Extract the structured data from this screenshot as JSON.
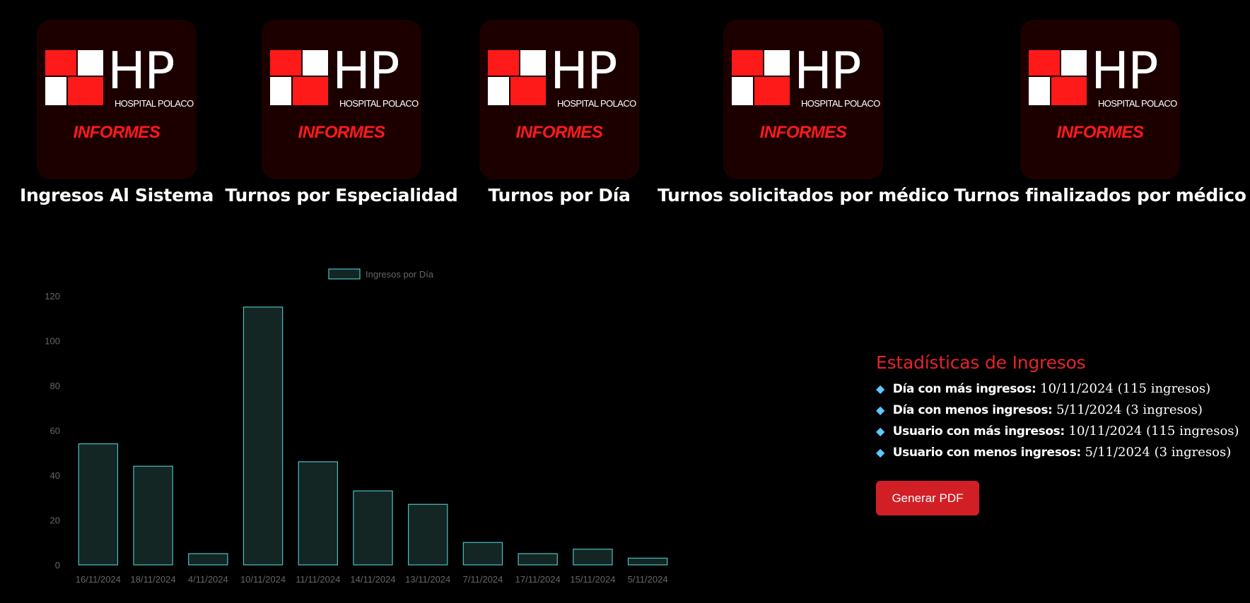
{
  "cards": [
    {
      "logo_letters": "HP",
      "logo_sub": "HOSPITAL POLACO",
      "logo_tag": "INFORMES",
      "label": "Ingresos Al Sistema"
    },
    {
      "logo_letters": "HP",
      "logo_sub": "HOSPITAL POLACO",
      "logo_tag": "INFORMES",
      "label": "Turnos por Especialidad"
    },
    {
      "logo_letters": "HP",
      "logo_sub": "HOSPITAL POLACO",
      "logo_tag": "INFORMES",
      "label": "Turnos por Día"
    },
    {
      "logo_letters": "HP",
      "logo_sub": "HOSPITAL POLACO",
      "logo_tag": "INFORMES",
      "label": "Turnos solicitados por médico"
    },
    {
      "logo_letters": "HP",
      "logo_sub": "HOSPITAL POLACO",
      "logo_tag": "INFORMES",
      "label": "Turnos finalizados por médico"
    }
  ],
  "chart_data": {
    "type": "bar",
    "categories": [
      "16/11/2024",
      "18/11/2024",
      "4/11/2024",
      "10/11/2024",
      "11/11/2024",
      "14/11/2024",
      "13/11/2024",
      "7/11/2024",
      "17/11/2024",
      "15/11/2024",
      "5/11/2024"
    ],
    "series": [
      {
        "name": "Ingresos por Día",
        "values": [
          54,
          44,
          5,
          115,
          46,
          33,
          27,
          10,
          5,
          7,
          3
        ]
      }
    ],
    "ylim": [
      0,
      120
    ],
    "yticks": [
      0,
      20,
      40,
      60,
      80,
      100,
      120
    ],
    "legend": "top",
    "grid": false,
    "colors": {
      "fill": "#132624",
      "stroke": "#4bc0c0",
      "tick_text": "#666666",
      "legend_text": "#666666"
    }
  },
  "stats": {
    "title": "Estadísticas de Ingresos",
    "rows": [
      {
        "key": "Día con más ingresos:",
        "value": "10/11/2024 (115 ingresos)"
      },
      {
        "key": "Día con menos ingresos:",
        "value": "5/11/2024 (3 ingresos)"
      },
      {
        "key": "Usuario con más ingresos:",
        "value": "10/11/2024 (115 ingresos)"
      },
      {
        "key": "Usuario con menos ingresos:",
        "value": "5/11/2024 (3 ingresos)"
      }
    ],
    "icon": "gem-icon"
  },
  "pdf_button": {
    "label": "Generar PDF"
  },
  "colors": {
    "accent": "#d21f26",
    "title": "#e3242b",
    "tile": "#1c0000",
    "logo_red": "#ff1a1a"
  }
}
